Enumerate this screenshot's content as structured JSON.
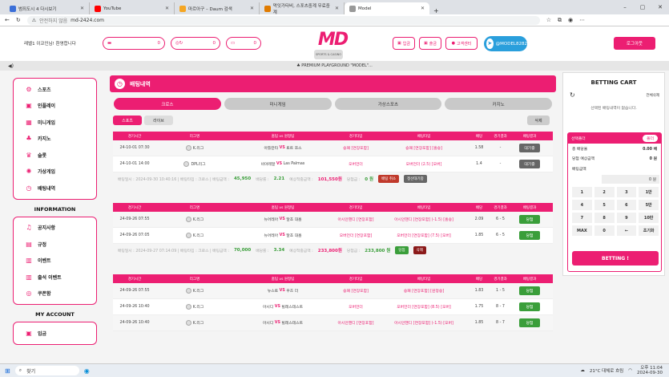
{
  "browser": {
    "tabs": [
      {
        "title": "범죄도시 4 다시보기",
        "color": "#3b6fd8",
        "active": false
      },
      {
        "title": "YouTube",
        "color": "#ff0000",
        "active": false
      },
      {
        "title": "마르아구 – Daum 검색",
        "color": "#f5a623",
        "active": false
      },
      {
        "title": "먹잇가타비, 스포츠중계 무료중계",
        "color": "#e07b00",
        "active": false
      },
      {
        "title": "Model",
        "color": "#999999",
        "active": true
      }
    ],
    "secure_label": "안전하지 않음",
    "url": "md-2424.com"
  },
  "header": {
    "welcome": "레벨1 이코인님! 환영합니다",
    "balance": "0",
    "point": "0",
    "coupon": "0",
    "logo_text": "MD",
    "logo_sub": "SPORTS & CASINO",
    "btn_deposit": "입금",
    "btn_withdraw": "출금",
    "btn_support": "고객센터",
    "telegram": "@MODEL8282",
    "logout": "로그아웃"
  },
  "ticker": "♣ PREMIUM PLAYGROUND \"MODEL\"...",
  "sidebar": {
    "items": [
      {
        "label": "스포츠",
        "icon": "⚙"
      },
      {
        "label": "인플레이",
        "icon": "▣"
      },
      {
        "label": "미니게임",
        "icon": "▦"
      },
      {
        "label": "카지노",
        "icon": "♣"
      },
      {
        "label": "슬롯",
        "icon": "♛"
      },
      {
        "label": "가상게임",
        "icon": "✺"
      },
      {
        "label": "배팅내역",
        "icon": "◷"
      }
    ],
    "info_title": "INFORMATION",
    "info_items": [
      {
        "label": "공지사항",
        "icon": "♫"
      },
      {
        "label": "규정",
        "icon": "▤"
      },
      {
        "label": "이벤트",
        "icon": "▥"
      },
      {
        "label": "출석 이벤트",
        "icon": "▥"
      },
      {
        "label": "쿠폰함",
        "icon": "◎"
      }
    ],
    "account_title": "MY ACCOUNT",
    "account_items": [
      {
        "label": "입금",
        "icon": "▣"
      }
    ]
  },
  "main": {
    "title": "배팅내역",
    "categories": [
      "크로스",
      "미니게임",
      "가상스포츠",
      "카지노"
    ],
    "subtabs": [
      "스포츠",
      "라이브"
    ],
    "delete_btn": "삭제",
    "columns": [
      "경기시간",
      "리그명",
      "홈팀 vs 원정팀",
      "경기타입",
      "베팅타입",
      "배당",
      "경기결과",
      "배팅결과"
    ],
    "groups": [
      {
        "rows": [
          {
            "time": "24-10-01 07:30",
            "league": "K.리그",
            "home": "아틀란타",
            "away": "토트 쪼스",
            "type": "승패 [연장포함]",
            "pick": "승패 [연장포함] [홈승]",
            "odds": "1.58",
            "score": "-",
            "result": "대기중",
            "status": "wait"
          },
          {
            "time": "24-10-01 14:00",
            "league": "DPL리그",
            "home": "비야레알",
            "away": "Las Palmas",
            "type": "오버언더",
            "pick": "오버언더 (2.5) [오버]",
            "odds": "1.4",
            "score": "-",
            "result": "대기중",
            "status": "wait"
          }
        ],
        "summary": {
          "text": "배팅일시 : 2024-09-30 10:40:16 | 배팅타입 : 크로스 | 배팅금액 :",
          "amount": "45,950",
          "odds_label": "배당률 :",
          "odds": "2.21",
          "win_label": "예상적중금액 :",
          "win": "101,550원",
          "result_label": "당첨금 :",
          "prize": "0 원",
          "btn1": "배팅 취소",
          "btn2": "정산대기중"
        }
      },
      {
        "rows": [
          {
            "time": "24-09-26 07:55",
            "league": "K.리그",
            "home": "뉴어레아",
            "away": "달초 대홈",
            "type": "아시안핸디 [연장포함]",
            "pick": "아시안핸디 [연장포함] (-1.5) [홈승]",
            "odds": "2.09",
            "score": "6 - 5",
            "result": "당첨",
            "status": "win"
          },
          {
            "time": "24-09-26 07:05",
            "league": "K.리그",
            "home": "뉴어레아",
            "away": "달초 대홈",
            "type": "오버언더 [연장포함]",
            "pick": "오버언더 [연장포함] (7.5) [오버]",
            "odds": "1.85",
            "score": "6 - 5",
            "result": "당첨",
            "status": "win"
          }
        ],
        "summary": {
          "text": "배팅일시 : 2024-09-27 07:14:09 | 배팅타입 : 크로스 | 배팅금액 :",
          "amount": "70,000",
          "odds_label": "배당률 :",
          "odds": "3.34",
          "win_label": "예상적중금액 :",
          "win": "233,800원",
          "result_label": "당첨금 :",
          "prize": "233,800 원",
          "btn1": "당첨",
          "btn2": "삭제"
        }
      },
      {
        "rows": [
          {
            "time": "24-09-26 07:55",
            "league": "K.리그",
            "home": "뉴스토",
            "away": "우즈 더",
            "type": "승패 [연장포함]",
            "pick": "승패 [연장포함] [원정승]",
            "odds": "1.83",
            "score": "1 - 5",
            "result": "당첨",
            "status": "win"
          },
          {
            "time": "24-09-26 10:40",
            "league": "K.리그",
            "home": "아시디",
            "away": "빌레스테스트",
            "type": "오버언더",
            "pick": "오버언더 [연장포함] (8.5) [오버]",
            "odds": "1.75",
            "score": "8 - 7",
            "result": "당첨",
            "status": "win"
          },
          {
            "time": "24-09-26 10:40",
            "league": "K.리그",
            "home": "아시디",
            "away": "빌레스테스트",
            "type": "아시안핸디 [연장포함]",
            "pick": "아시안핸디 [연장포함] (-1.5) [오버]",
            "odds": "1.85",
            "score": "8 - 7",
            "result": "당첨",
            "status": "win"
          }
        ]
      }
    ]
  },
  "cart": {
    "title": "BETTING CART",
    "fold_label": "전체삭제",
    "empty": "선택된 배팅내역이 없습니다.",
    "single_label": "선택폴더",
    "clear_btn": "폴더",
    "total_odds_label": "총 배당율",
    "total_odds": "0.00 배",
    "expected_label": "당첨 예상금액",
    "expected": "0 원",
    "bet_amount_label": "배팅금액",
    "bet_amount": "0 원",
    "keys": [
      "1",
      "2",
      "3",
      "1만",
      "4",
      "5",
      "6",
      "5만",
      "7",
      "8",
      "9",
      "10만",
      "MAX",
      "0",
      "←",
      "초기화"
    ],
    "bet_btn": "BETTING !"
  },
  "taskbar": {
    "search": "찾기",
    "weather": "21°C 대체로 흐림",
    "time": "오후 11:04",
    "date": "2024-09-30"
  }
}
